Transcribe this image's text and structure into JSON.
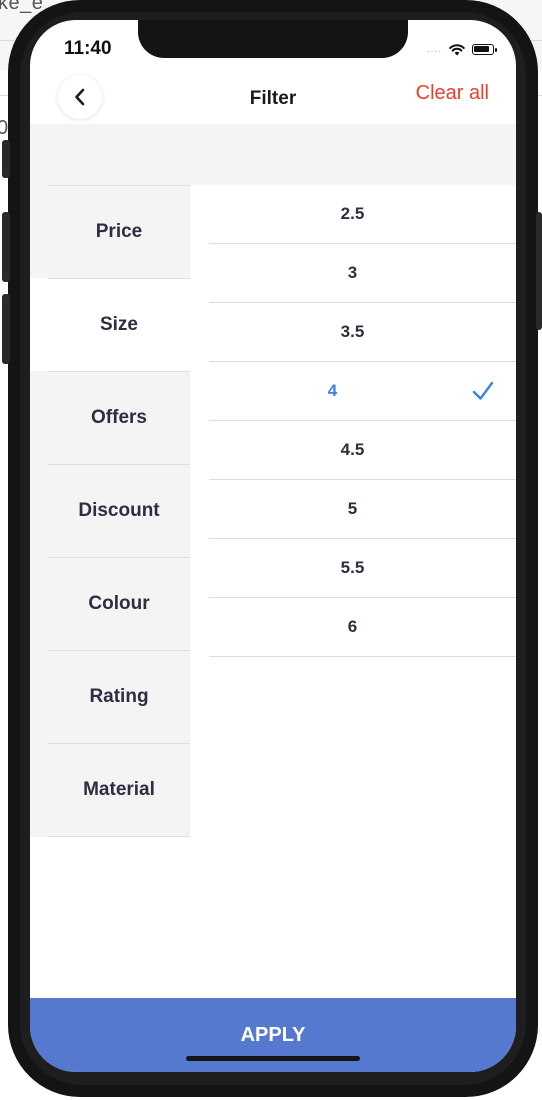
{
  "background": {
    "tab_text": "ke_e",
    "side_text": "0"
  },
  "status_bar": {
    "time": "11:40",
    "signal_dots": "....",
    "wifi_icon": "wifi-icon",
    "battery_icon": "battery-icon"
  },
  "header": {
    "title": "Filter",
    "clear_all": "Clear all",
    "back_icon": "chevron-left-icon"
  },
  "categories": [
    {
      "label": "Price",
      "active": false
    },
    {
      "label": "Size",
      "active": true
    },
    {
      "label": "Offers",
      "active": false
    },
    {
      "label": "Discount",
      "active": false
    },
    {
      "label": "Colour",
      "active": false
    },
    {
      "label": "Rating",
      "active": false
    },
    {
      "label": "Material",
      "active": false
    }
  ],
  "options": [
    {
      "label": "2.5",
      "selected": false
    },
    {
      "label": "3",
      "selected": false
    },
    {
      "label": "3.5",
      "selected": false
    },
    {
      "label": "4",
      "selected": true
    },
    {
      "label": "4.5",
      "selected": false
    },
    {
      "label": "5",
      "selected": false
    },
    {
      "label": "5.5",
      "selected": false
    },
    {
      "label": "6",
      "selected": false
    }
  ],
  "footer": {
    "apply_label": "APPLY"
  },
  "colors": {
    "accent": "#3b82e0",
    "clear_all": "#e8412b",
    "apply_bg": "#5679d0"
  }
}
